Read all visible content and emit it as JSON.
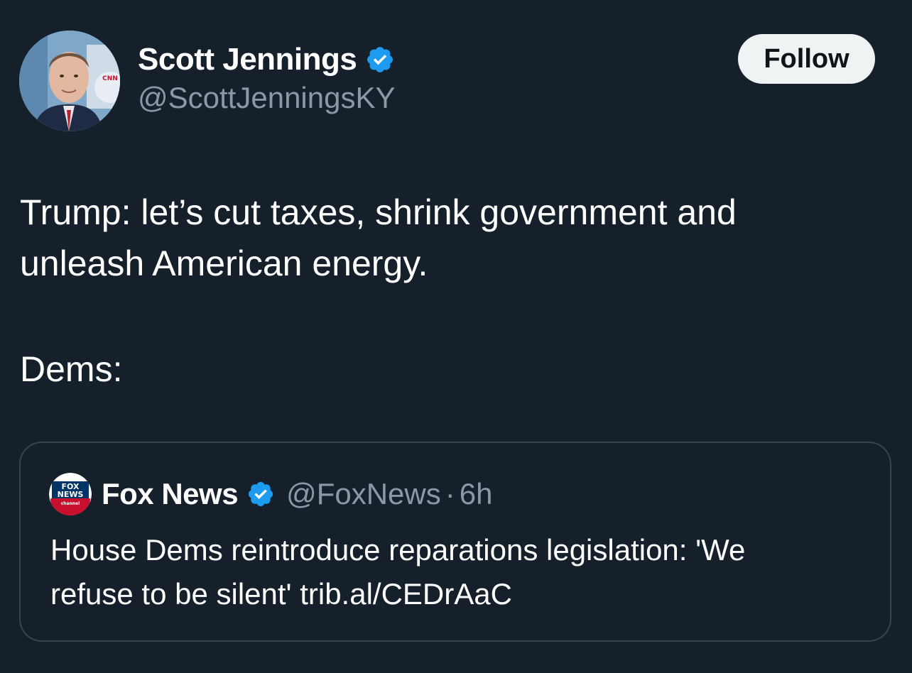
{
  "tweet": {
    "author": {
      "display_name": "Scott Jennings",
      "handle": "@ScottJenningsKY",
      "verified": true
    },
    "follow_label": "Follow",
    "text_lines": [
      "Trump: let’s cut taxes, shrink government and",
      "unleash American energy.",
      "Dems:"
    ]
  },
  "quoted_tweet": {
    "author": {
      "display_name": "Fox News",
      "handle": "@FoxNews",
      "verified": true,
      "logo_text": [
        "FOX",
        "NEWS",
        "channel"
      ]
    },
    "separator": "·",
    "time": "6h",
    "text_lines": [
      "House Dems reintroduce reparations legislation: 'We",
      "refuse to be silent' trib.al/CEDrAaC"
    ]
  },
  "colors": {
    "background": "#15202b",
    "secondary_text": "#8b98a5",
    "verified_blue": "#1d9bf0",
    "follow_button_bg": "#eff3f4",
    "border": "#38444d"
  },
  "icons": {
    "verified": "verified-badge-icon",
    "avatar": "profile-photo",
    "quote_logo": "fox-news-logo"
  }
}
